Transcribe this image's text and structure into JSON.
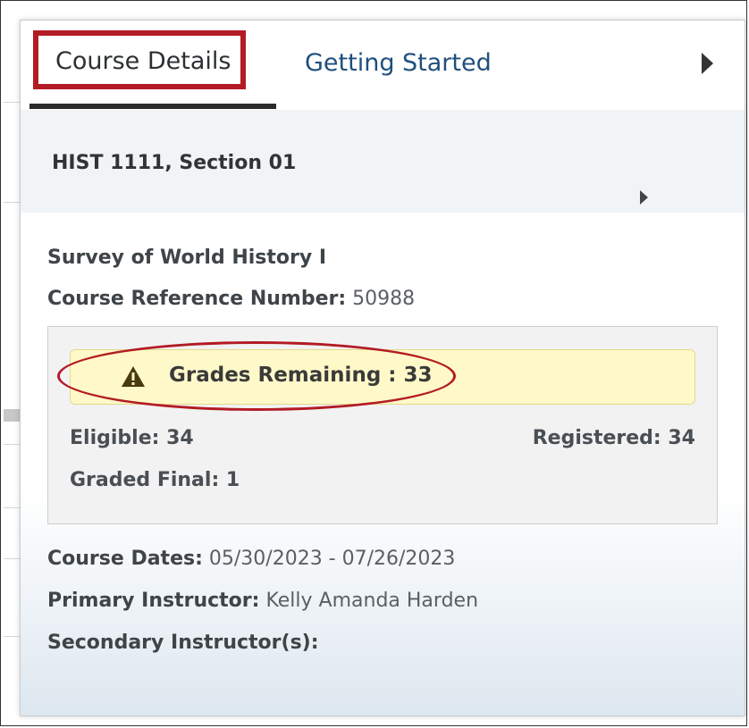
{
  "tabs": {
    "course_details": "Course Details",
    "getting_started": "Getting Started",
    "next_icon": "triangle-right-icon"
  },
  "section": {
    "title": "HIST 1111, Section 01",
    "expand_icon": "triangle-right-icon"
  },
  "course": {
    "name": "Survey of World History I",
    "crn_label": "Course Reference Number:",
    "crn_value": "50988",
    "dates_label": "Course Dates:",
    "dates_value": "05/30/2023 - 07/26/2023",
    "primary_label": "Primary Instructor:",
    "primary_value": "Kelly Amanda Harden",
    "secondary_label": "Secondary Instructor(s):"
  },
  "stats": {
    "alert_icon": "warning-icon",
    "grades_remaining": "Grades Remaining : 33",
    "eligible": "Eligible: 34",
    "registered": "Registered: 34",
    "graded_final": "Graded Final: 1"
  },
  "colors": {
    "highlight": "#b31b24",
    "tab_link": "#1f4f7d",
    "alert_bg": "#fff9c9"
  }
}
